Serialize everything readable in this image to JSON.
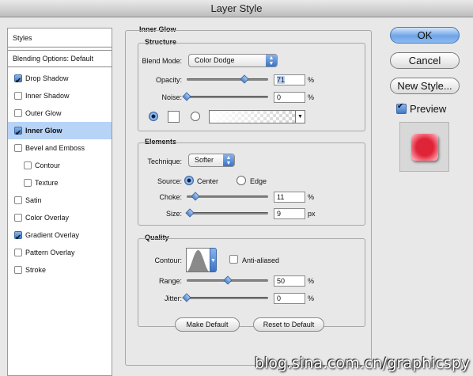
{
  "window": {
    "title": "Layer Style"
  },
  "sidebar": {
    "header": "Styles",
    "blending": "Blending Options: Default",
    "items": [
      {
        "label": "Drop Shadow",
        "checked": true,
        "selected": false,
        "indent": false
      },
      {
        "label": "Inner Shadow",
        "checked": false,
        "selected": false,
        "indent": false
      },
      {
        "label": "Outer Glow",
        "checked": false,
        "selected": false,
        "indent": false
      },
      {
        "label": "Inner Glow",
        "checked": true,
        "selected": true,
        "indent": false
      },
      {
        "label": "Bevel and Emboss",
        "checked": false,
        "selected": false,
        "indent": false
      },
      {
        "label": "Contour",
        "checked": false,
        "selected": false,
        "indent": true
      },
      {
        "label": "Texture",
        "checked": false,
        "selected": false,
        "indent": true
      },
      {
        "label": "Satin",
        "checked": false,
        "selected": false,
        "indent": false
      },
      {
        "label": "Color Overlay",
        "checked": false,
        "selected": false,
        "indent": false
      },
      {
        "label": "Gradient Overlay",
        "checked": true,
        "selected": false,
        "indent": false
      },
      {
        "label": "Pattern Overlay",
        "checked": false,
        "selected": false,
        "indent": false
      },
      {
        "label": "Stroke",
        "checked": false,
        "selected": false,
        "indent": false
      }
    ]
  },
  "panel": {
    "title": "Inner Glow",
    "structure": {
      "title": "Structure",
      "blend_mode_label": "Blend Mode:",
      "blend_mode": "Color Dodge",
      "opacity_label": "Opacity:",
      "opacity": "71",
      "opacity_level": 0.71,
      "noise_label": "Noise:",
      "noise": "0",
      "noise_level": 0,
      "percent": "%"
    },
    "elements": {
      "title": "Elements",
      "technique_label": "Technique:",
      "technique": "Softer",
      "source_label": "Source:",
      "source_center": "Center",
      "source_edge": "Edge",
      "choke_label": "Choke:",
      "choke": "11",
      "choke_level": 0.11,
      "size_label": "Size:",
      "size": "9",
      "size_level": 0.036,
      "percent": "%",
      "px": "px"
    },
    "quality": {
      "title": "Quality",
      "contour_label": "Contour:",
      "anti_aliased": "Anti-aliased",
      "range_label": "Range:",
      "range": "50",
      "range_level": 0.5,
      "jitter_label": "Jitter:",
      "jitter": "0",
      "jitter_level": 0,
      "percent": "%"
    },
    "make_default": "Make Default",
    "reset_default": "Reset to Default"
  },
  "actions": {
    "ok": "OK",
    "cancel": "Cancel",
    "new_style": "New Style...",
    "preview": "Preview"
  },
  "watermark": "blog.sina.com.cn/graphicspy"
}
